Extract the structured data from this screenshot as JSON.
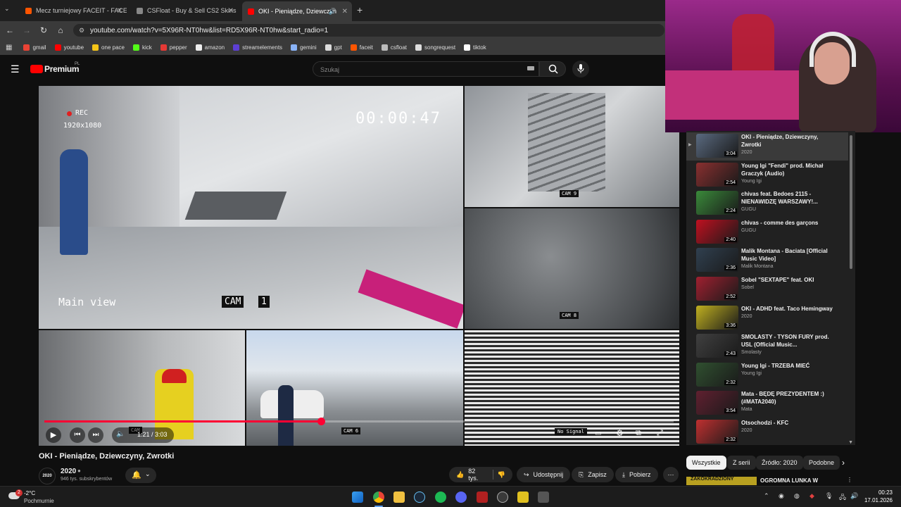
{
  "browser": {
    "tabs": [
      {
        "label": "Mecz turniejowy FACEIT - FACE",
        "favicon_color": "#ff5500"
      },
      {
        "label": "CSFloat - Buy & Sell CS2 Skins",
        "favicon_color": "#2b2b2b"
      },
      {
        "label": "OKI - Pieniądze, Dziewczyn",
        "favicon_color": "#ff0000"
      }
    ],
    "new_tab": "+",
    "url": "youtube.com/watch?v=5X96R-NT0hw&list=RD5X96R-NT0hw&start_radio=1",
    "bookmarks": [
      {
        "label": "gmail",
        "color": "#ea4335"
      },
      {
        "label": "youtube",
        "color": "#ff0000"
      },
      {
        "label": "one pace",
        "color": "#f5c518"
      },
      {
        "label": "kick",
        "color": "#53fc18"
      },
      {
        "label": "pepper",
        "color": "#e53935"
      },
      {
        "label": "amazon",
        "color": "#eeeeee"
      },
      {
        "label": "streamelements",
        "color": "#5d3fd3"
      },
      {
        "label": "gemini",
        "color": "#8ab4f8"
      },
      {
        "label": "gpt",
        "color": "#dddddd"
      },
      {
        "label": "faceit",
        "color": "#ff5500"
      },
      {
        "label": "csfloat",
        "color": "#bbbbbb"
      },
      {
        "label": "songrequest",
        "color": "#dddddd"
      },
      {
        "label": "tiktok",
        "color": "#ffffff"
      }
    ]
  },
  "youtube": {
    "logo": "Premium",
    "logo_region": "PL",
    "search_placeholder": "Szukaj",
    "player": {
      "rec_label": "REC",
      "resolution": "1920x1080",
      "timecode": "00:00:47",
      "main_view": "Main view",
      "cam_main": "CAM",
      "cam_main_num": "1",
      "cam_labels": [
        "CAM 9",
        "CAM 8",
        "CAM 6"
      ],
      "no_signal": "No Signal",
      "time_display": "1:21 / 3:03",
      "progress": 0.44
    },
    "video_title": "OKI - Pieniądze, Dziewczyny, Zwrotki",
    "channel": {
      "name": "2020",
      "avatar_text": "2020",
      "subscribers": "946 tys. subskrybentów"
    },
    "actions": {
      "likes": "82 tys.",
      "share": "Udostępnij",
      "save": "Zapisz",
      "download": "Pobierz",
      "more": "⋯"
    },
    "playlist": [
      {
        "title": "OKI - Pieniądze, Dziewczyny, Zwrotki",
        "sub": "2020",
        "dur": "3:04",
        "color": "#5a6a80",
        "current": true
      },
      {
        "title": "Young Igi \"Fendi\" prod. Michał Graczyk (Audio)",
        "sub": "Young Igi",
        "dur": "2:54",
        "color": "#8a3030"
      },
      {
        "title": "chivas feat. Bedoes 2115 - NIENAWIDZĘ WARSZAWY!...",
        "sub": "GUGU",
        "dur": "2:24",
        "color": "#3a8a3a"
      },
      {
        "title": "chivas - comme des garçons",
        "sub": "GUGU",
        "dur": "2:40",
        "color": "#c01020"
      },
      {
        "title": "Malik Montana - Baciata [Official Music Video]",
        "sub": "Malik Montana",
        "dur": "2:36",
        "color": "#304050"
      },
      {
        "title": "Sobel \"SEXTAPE\" feat. OKI",
        "sub": "Sobel",
        "dur": "2:52",
        "color": "#a02030"
      },
      {
        "title": "OKI - ADHD feat. Taco Hemingway",
        "sub": "2020",
        "dur": "3:36",
        "color": "#c0b020"
      },
      {
        "title": "SMOLASTY - TYSON FURY prod. USL (Official Music...",
        "sub": "Smolasty",
        "dur": "2:43",
        "color": "#404040"
      },
      {
        "title": "Young Igi - TRZEBA MIEĆ",
        "sub": "Young Igi",
        "dur": "2:32",
        "color": "#305030"
      },
      {
        "title": "Mata - BĘDĘ PREZYDENTEM :) (#MATA2040)",
        "sub": "Mata",
        "dur": "3:54",
        "color": "#602030"
      },
      {
        "title": "Otsochodzi - KFC",
        "sub": "2020",
        "dur": "2:32",
        "color": "#c03030"
      }
    ],
    "chips": [
      "Wszystkie",
      "Z serii",
      "Źródło: 2020",
      "Podobne"
    ],
    "recommended": {
      "thumb_text": "ZAKOKRADZIONY",
      "title": "OGROMNA LUNKA W"
    }
  },
  "taskbar": {
    "weather_temp": "-2°C",
    "weather_desc": "Pochmurnie",
    "weather_badge": "2",
    "time": "00:23",
    "date": "17.01.2026"
  }
}
